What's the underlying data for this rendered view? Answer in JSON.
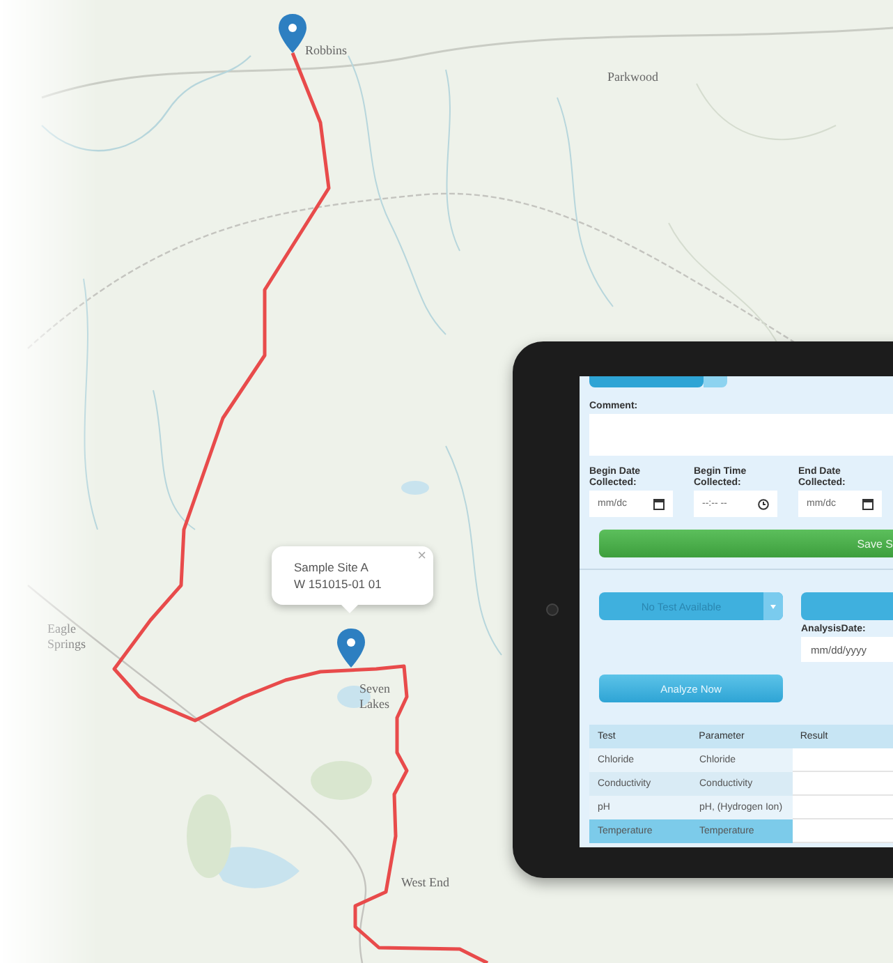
{
  "map": {
    "labels": [
      {
        "text": "Robbins"
      },
      {
        "text": "Parkwood"
      },
      {
        "text": "Eagle Springs"
      },
      {
        "text": "Seven Lakes"
      },
      {
        "text": "West End"
      }
    ],
    "popup": {
      "title": "Sample Site A",
      "subtitle": "W 151015-01 01",
      "close": "×"
    }
  },
  "form": {
    "comment_label": "Comment:",
    "date_fields": [
      {
        "label": "Begin Date Collected:",
        "placeholder": "mm/dc",
        "kind": "date"
      },
      {
        "label": "Begin Time Collected:",
        "placeholder": "--:-- --",
        "kind": "time"
      },
      {
        "label": "End Date Collected:",
        "placeholder": "mm/dc",
        "kind": "date"
      }
    ],
    "save_button": "Save S",
    "test_dropdown": "No Test Available",
    "analysis_date_label": "AnalysisDate:",
    "analysis_date_placeholder": "mm/dd/yyyy",
    "analyze_button": "Analyze Now",
    "table": {
      "columns": [
        "Test",
        "Parameter",
        "Result"
      ],
      "rows": [
        {
          "test": "Chloride",
          "parameter": "Chloride",
          "selected": false
        },
        {
          "test": "Conductivity",
          "parameter": "Conductivity",
          "selected": false
        },
        {
          "test": "pH",
          "parameter": "pH, (Hydrogen Ion)",
          "selected": false
        },
        {
          "test": "Temperature",
          "parameter": "Temperature",
          "selected": true
        }
      ]
    }
  }
}
